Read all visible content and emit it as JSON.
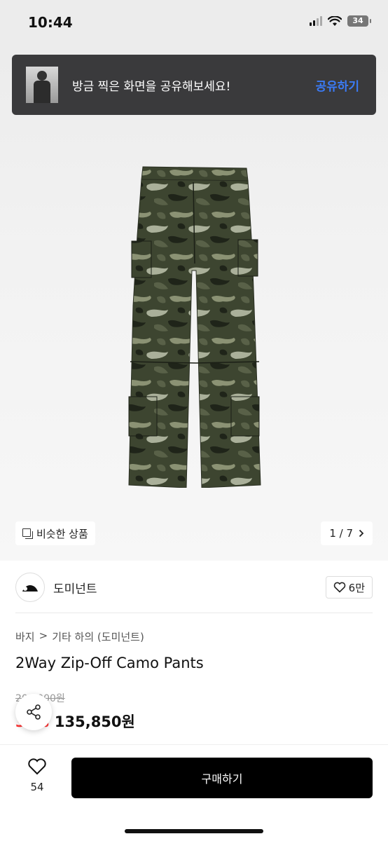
{
  "status_bar": {
    "time": "10:44",
    "battery": "34"
  },
  "toast": {
    "message": "방금 찍은 화면을 공유해보세요!",
    "action": "공유하기"
  },
  "gallery": {
    "similar_label": "비슷한 상품",
    "pager": "1 / 7"
  },
  "brand": {
    "name": "도미넌트",
    "likes": "6만"
  },
  "breadcrumb": {
    "category": "바지",
    "separator": ">",
    "subcategory": "기타 하의 (도미넌트)"
  },
  "product": {
    "title": "2Way Zip-Off Camo Pants",
    "original_price": "209,000원",
    "discount": "35%",
    "sale_price": "135,850원"
  },
  "bottom_bar": {
    "wish_count": "54",
    "buy_label": "구매하기"
  },
  "colors": {
    "accent_blue": "#3b7bf6",
    "discount_red": "#ff3333",
    "buy_button": "#000000"
  }
}
